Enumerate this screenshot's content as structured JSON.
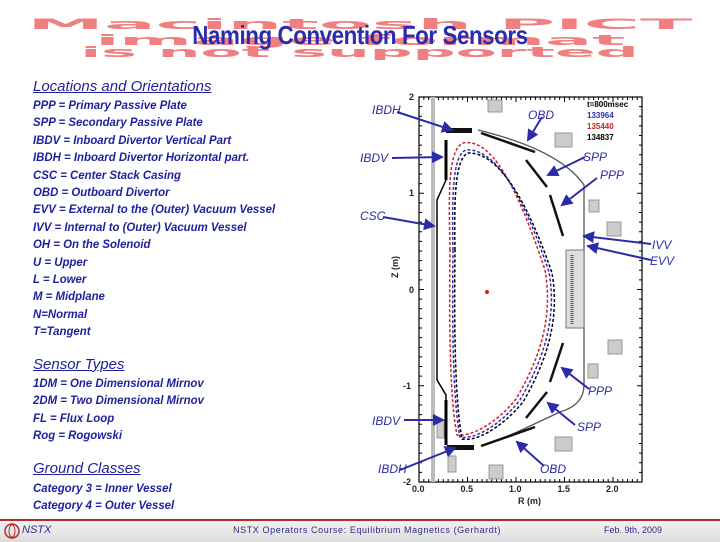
{
  "watermark": {
    "line1": "Macintosh PICT",
    "line2": "image format",
    "line3": "is not supported"
  },
  "title": "Naming Convention For Sensors",
  "locations": {
    "heading": "Locations and Orientations",
    "items": [
      "PPP    = Primary Passive Plate",
      "SPP    = Secondary Passive Plate",
      "IBDV  = Inboard Divertor Vertical Part",
      "IBDH  = Inboard Divertor Horizontal part.",
      "CSC  = Center Stack Casing",
      "OBD  = Outboard Divertor",
      "EVV   = External to the (Outer) Vacuum Vessel",
      "IVV   = Internal to (Outer) Vacuum Vessel",
      "OH    = On the Solenoid",
      "U        = Upper",
      "L        = Lower",
      "M       = Midplane",
      "N=Normal",
      "T=Tangent"
    ]
  },
  "sensor_types": {
    "heading": "Sensor Types",
    "items": [
      "1DM  = One Dimensional Mirnov",
      "2DM  = Two Dimensional Mirnov",
      "FL     = Flux Loop",
      "Rog   = Rogowski"
    ]
  },
  "ground_classes": {
    "heading": "Ground Classes",
    "items": [
      "Category 3 = Inner Vessel",
      "Category 4 =  Outer Vessel"
    ]
  },
  "figure": {
    "xlabel": "R (m)",
    "ylabel": "Z (m)",
    "xticks": [
      "0.0",
      "0.5",
      "1.0",
      "1.5",
      "2.0"
    ],
    "yticks": [
      "2",
      "1",
      "0",
      "-1",
      "-2"
    ],
    "legend": [
      {
        "text": "t=800msec",
        "color": "#000000"
      },
      {
        "text": "133964",
        "color": "#2b2bc0"
      },
      {
        "text": "135440",
        "color": "#d02020"
      },
      {
        "text": "134837",
        "color": "#000000"
      }
    ],
    "labels": {
      "ibdh_top": "IBDH",
      "obd_top": "OBD",
      "ibdv_top": "IBDV",
      "spp_top": "SPP",
      "ppp_top": "PPP",
      "csc": "CSC",
      "ivv": "IVV",
      "evv": "EVV",
      "ppp_bot": "PPP",
      "ibdv_bot": "IBDV",
      "spp_bot": "SPP",
      "ibdh_bot": "IBDH",
      "obd_bot": "OBD"
    }
  },
  "footer": {
    "logo": "NSTX",
    "course": "NSTX Operators Course: Equilibrium Magnetics (Gerhardt)",
    "date": "Feb. 9th, 2009"
  },
  "colors": {
    "text_blue": "#1f1f9e",
    "watermark": "#f08080",
    "footer_rule": "#b03030"
  }
}
